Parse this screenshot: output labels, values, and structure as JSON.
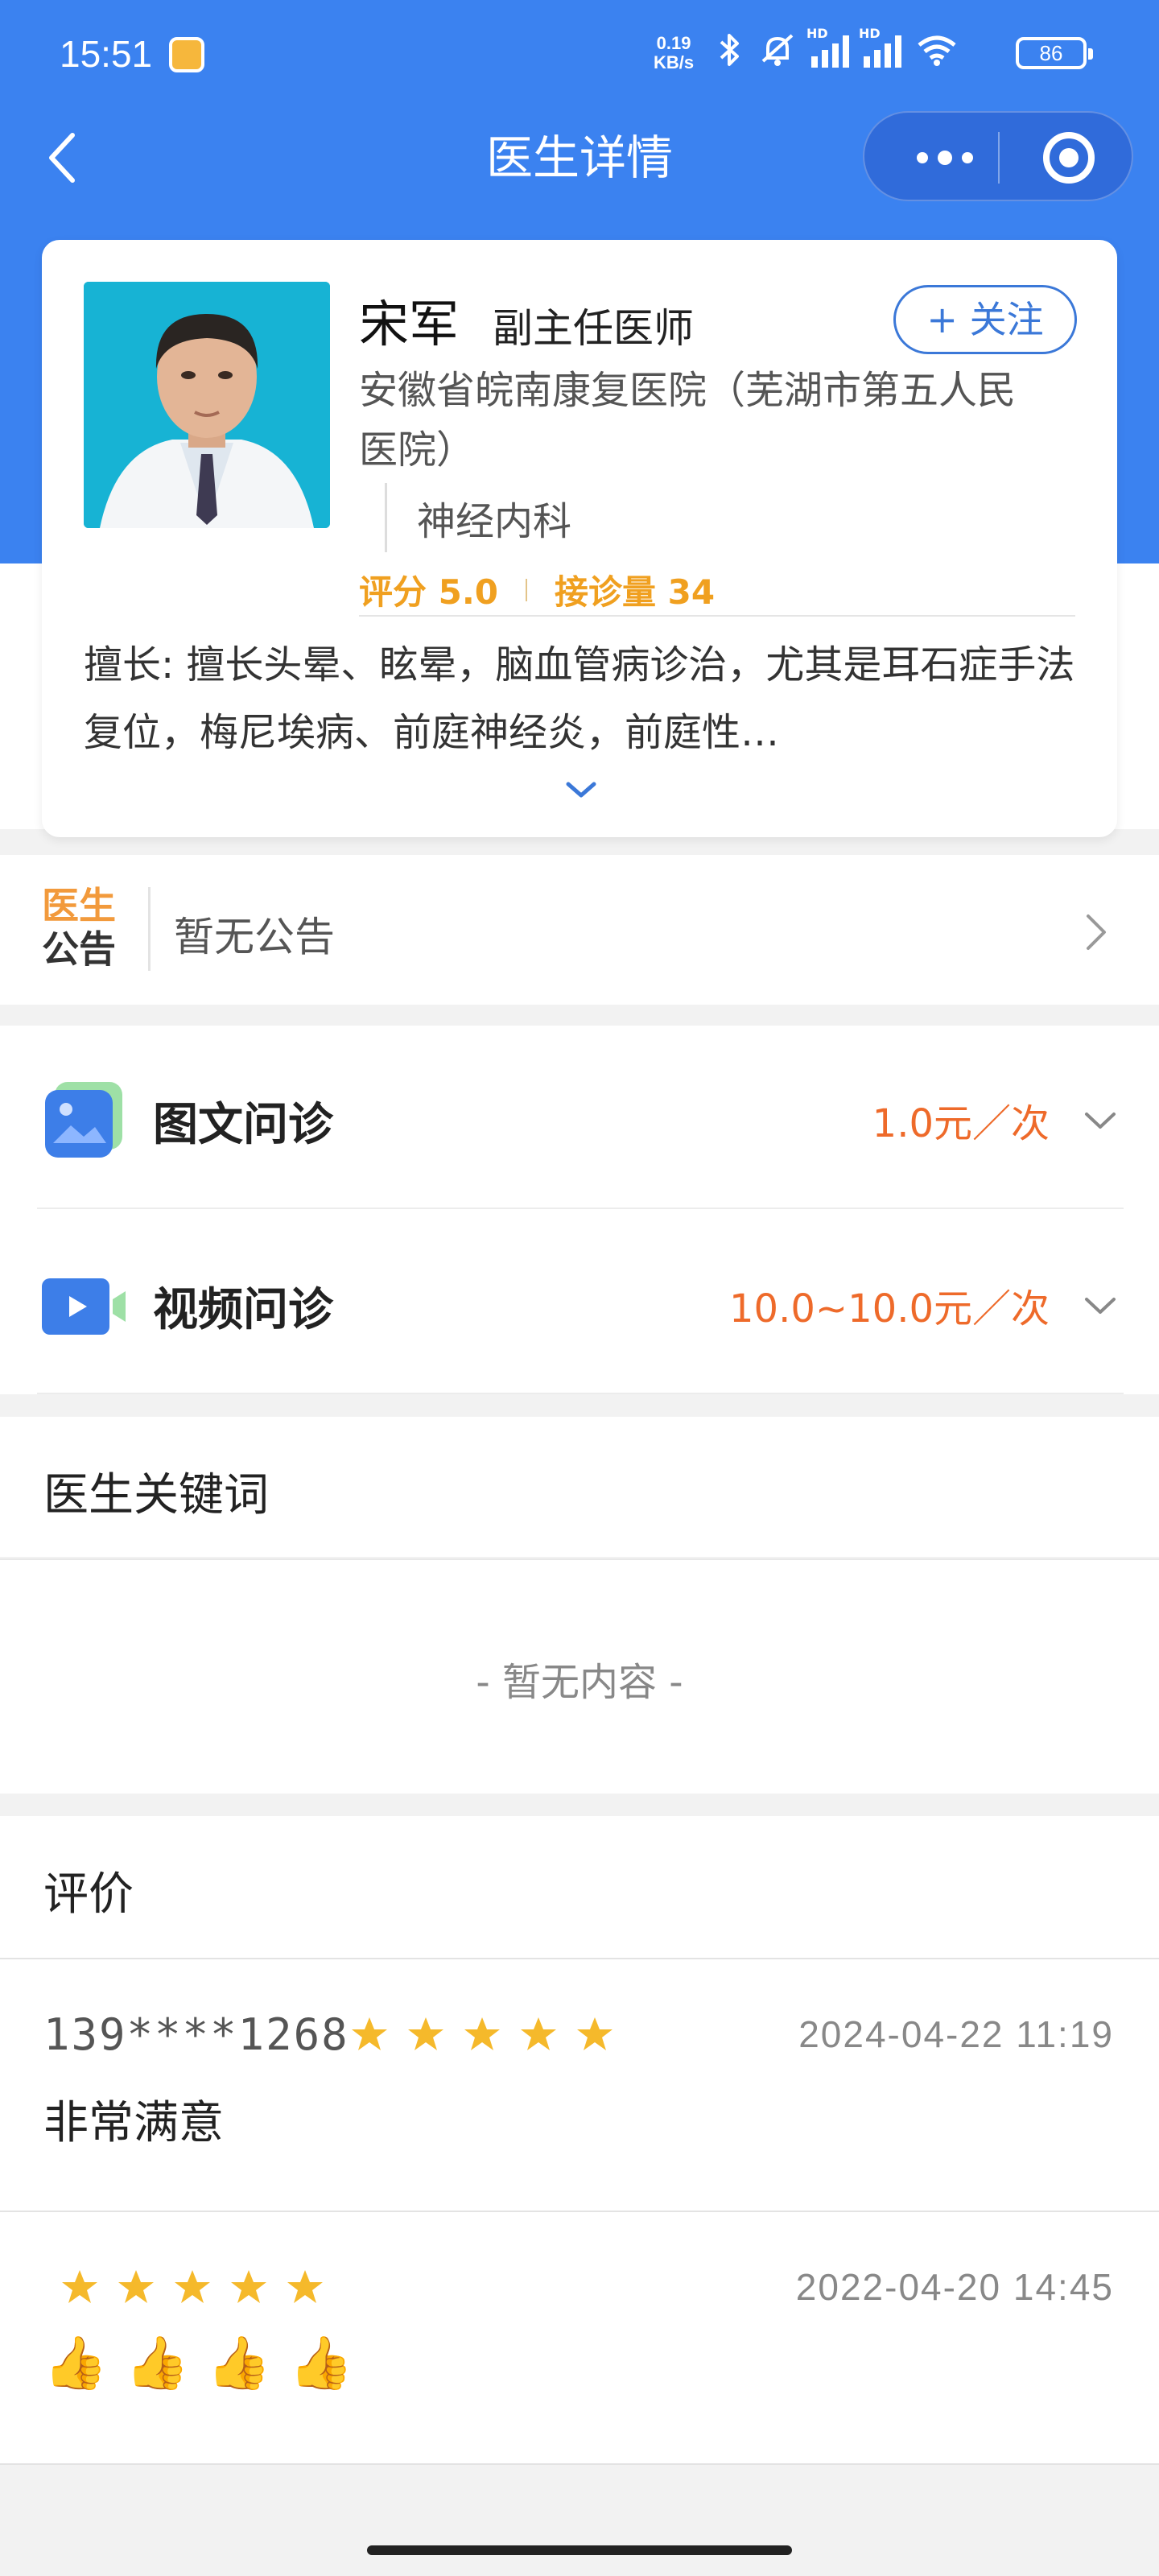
{
  "status_bar": {
    "time": "15:51",
    "net_speed_value": "0.19",
    "net_speed_unit": "KB/s",
    "signal_label": "HD",
    "battery": "86"
  },
  "nav": {
    "title": "医生详情",
    "back_icon": "chevron-left-icon",
    "more_icon": "more-dots-icon",
    "target_icon": "target-icon"
  },
  "doctor": {
    "name": "宋军",
    "title": "副主任医师",
    "follow_label": "+ 关注",
    "hospital": "安徽省皖南康复医院（芜湖市第五人民医院）",
    "department": "神经内科",
    "rating": "评分 5.0",
    "consultations": "接诊量 34",
    "expertise": "擅长: 擅长头晕、眩晕，脑血管病诊治，尤其是耳石症手法复位，梅尼埃病、前庭神经炎，前庭性…"
  },
  "notice": {
    "logo_line1": "医生",
    "logo_line2": "公告",
    "text": "暂无公告"
  },
  "services": [
    {
      "name": "图文问诊",
      "price": "1.0元／次",
      "icon": "image-chat-icon"
    },
    {
      "name": "视频问诊",
      "price": "10.0~10.0元／次",
      "icon": "video-icon"
    }
  ],
  "keywords": {
    "title": "医生关键词",
    "empty_text": "- 暂无内容 -"
  },
  "reviews": {
    "title": "评价",
    "items": [
      {
        "user": "139****1268",
        "stars": 5,
        "date": "2024-04-22 11:19",
        "text": "非常满意"
      },
      {
        "user": "",
        "stars": 5,
        "date": "2022-04-20 14:45",
        "text": "👍👍👍👍"
      }
    ]
  },
  "colors": {
    "primary": "#3b82f0",
    "price": "#ee6a2a",
    "rating": "#f0a020",
    "star": "#f5b92b"
  }
}
